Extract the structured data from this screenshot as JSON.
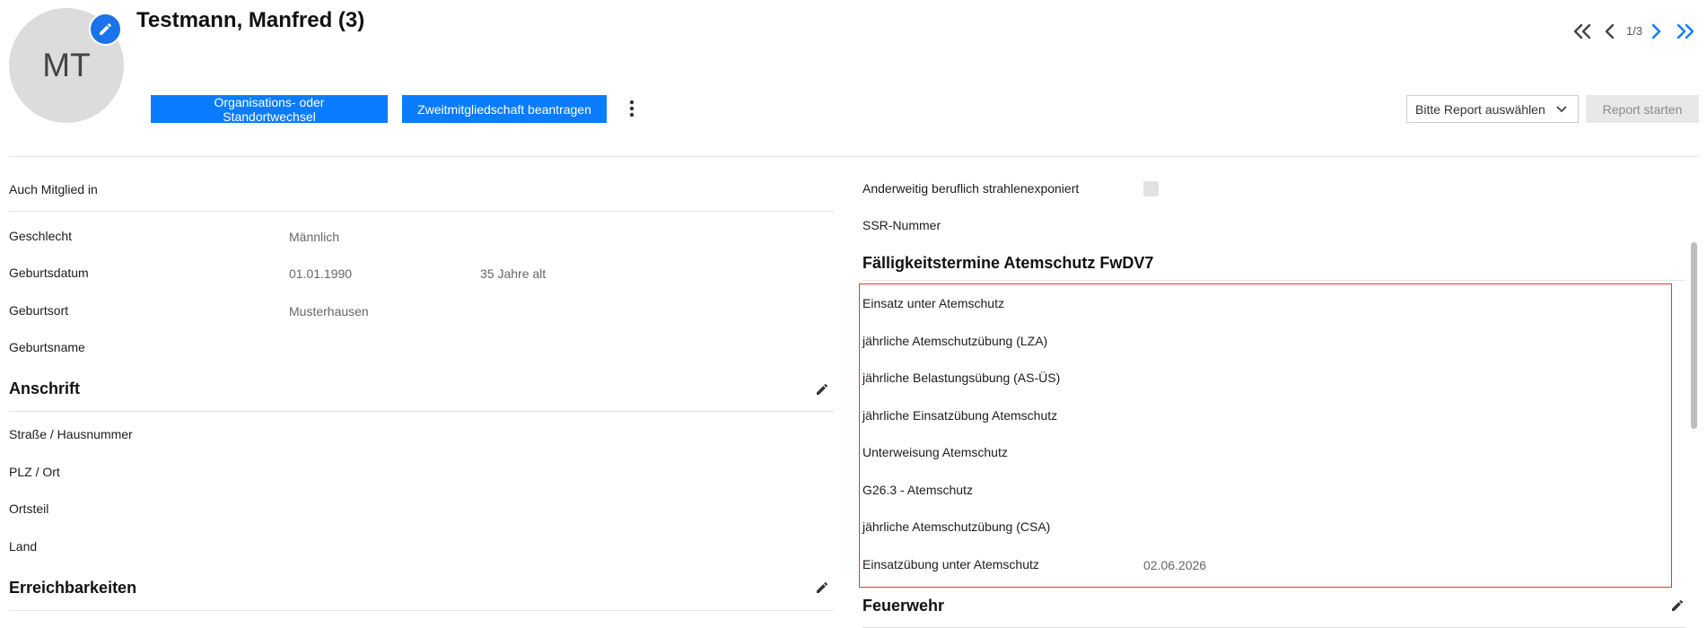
{
  "header": {
    "avatar_initials": "MT",
    "title": "Testmann, Manfred (3)",
    "buttons": {
      "org_change": "Organisations- oder Standortwechsel",
      "second_membership": "Zweitmitgliedschaft beantragen"
    },
    "pagination": {
      "info": "1/3"
    },
    "report": {
      "select_value": "Bitte Report auswählen",
      "start_label": "Report starten"
    }
  },
  "left": {
    "also_member_label": "Auch Mitglied in",
    "personal": [
      {
        "label": "Geschlecht",
        "value": "Männlich",
        "extra": ""
      },
      {
        "label": "Geburtsdatum",
        "value": "01.01.1990",
        "extra": "35 Jahre alt"
      },
      {
        "label": "Geburtsort",
        "value": "Musterhausen",
        "extra": ""
      },
      {
        "label": "Geburtsname",
        "value": "",
        "extra": ""
      }
    ],
    "address": {
      "title": "Anschrift",
      "fields": [
        "Straße / Hausnummer",
        "PLZ / Ort",
        "Ortsteil",
        "Land"
      ]
    },
    "contact": {
      "title": "Erreichbarkeiten"
    }
  },
  "right": {
    "radiation_label": "Anderweitig beruflich strahlenexponiert",
    "ssr_label": "SSR-Nummer",
    "due_dates": {
      "title": "Fälligkeitstermine Atemschutz FwDV7",
      "items": [
        {
          "label": "Einsatz unter Atemschutz",
          "value": ""
        },
        {
          "label": "jährliche Atemschutzübung (LZA)",
          "value": ""
        },
        {
          "label": "jährliche Belastungsübung (AS-ÜS)",
          "value": ""
        },
        {
          "label": "jährliche Einsatzübung Atemschutz",
          "value": ""
        },
        {
          "label": "Unterweisung Atemschutz",
          "value": ""
        },
        {
          "label": "G26.3 - Atemschutz",
          "value": ""
        },
        {
          "label": "jährliche Atemschutzübung (CSA)",
          "value": ""
        },
        {
          "label": "Einsatzübung unter Atemschutz",
          "value": "02.06.2026"
        }
      ]
    },
    "fire_dept": {
      "title": "Feuerwehr"
    }
  },
  "icons": {
    "avatar_edit": "pencil-icon",
    "kebab": "more-vertical-icon",
    "first": "double-chevron-left-icon",
    "prev": "chevron-left-icon",
    "next": "chevron-right-icon",
    "last": "double-chevron-right-icon",
    "select": "chevron-down-icon",
    "section_edit": "pencil-icon"
  },
  "colors": {
    "primary": "#0a7cff",
    "highlight_border": "#e2343a",
    "avatar_bg": "#dcdcdc"
  }
}
